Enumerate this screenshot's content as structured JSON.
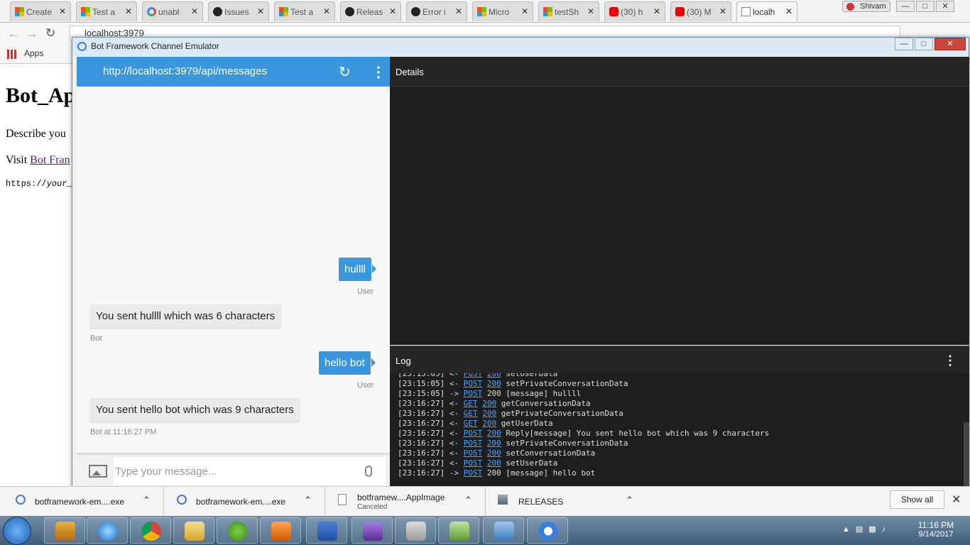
{
  "browser": {
    "tabs": [
      {
        "title": "Create",
        "favicon": "microsoft-icon"
      },
      {
        "title": "Test a",
        "favicon": "microsoft-icon"
      },
      {
        "title": "unabl",
        "favicon": "google-icon"
      },
      {
        "title": "Issues",
        "favicon": "github-icon"
      },
      {
        "title": "Test a",
        "favicon": "microsoft-icon"
      },
      {
        "title": "Releas",
        "favicon": "github-icon"
      },
      {
        "title": "Error i",
        "favicon": "github-icon"
      },
      {
        "title": "Micro",
        "favicon": "microsoft-icon"
      },
      {
        "title": "testSh",
        "favicon": "microsoft-icon"
      },
      {
        "title": "(30) h",
        "favicon": "youtube-icon"
      },
      {
        "title": "(30) M",
        "favicon": "youtube-icon"
      },
      {
        "title": "localh",
        "favicon": "page-icon"
      }
    ],
    "user": "Shivam",
    "address": "localhost:3979",
    "bookmarks_apps": "Apps"
  },
  "page": {
    "heading": "Bot_Ap",
    "desc": "Describe you",
    "visit_prefix": "Visit ",
    "visit_link": "Bot Fran",
    "code_prefix": "https://",
    "code_italic": "your_"
  },
  "emulator": {
    "window_title": "Bot Framework Channel Emulator",
    "endpoint": "http://localhost:3979/api/messages",
    "details_title": "Details",
    "log_title": "Log",
    "input_placeholder": "Type your message...",
    "messages": [
      {
        "from": "user",
        "text": "hullll",
        "meta": "User"
      },
      {
        "from": "bot",
        "text": "You sent hullll which was 6 characters",
        "meta": "Bot"
      },
      {
        "from": "user",
        "text": "hello bot",
        "meta": "User"
      },
      {
        "from": "bot",
        "text": "You sent hello bot which was 9 characters",
        "meta": "Bot at 11:16:27 PM"
      }
    ],
    "log": [
      {
        "time": "[23:15:05]",
        "dir": "<-",
        "method": "POST",
        "status": "200",
        "text": "setUserData",
        "status_link": true
      },
      {
        "time": "[23:15:05]",
        "dir": "<-",
        "method": "POST",
        "status": "200",
        "text": "setPrivateConversationData",
        "status_link": true
      },
      {
        "time": "[23:15:05]",
        "dir": "->",
        "method": "POST",
        "status": "200",
        "text": "[message] hullll",
        "status_link": false
      },
      {
        "time": "[23:16:27]",
        "dir": "<-",
        "method": "GET",
        "status": "200",
        "text": "getConversationData",
        "status_link": true
      },
      {
        "time": "[23:16:27]",
        "dir": "<-",
        "method": "GET",
        "status": "200",
        "text": "getPrivateConversationData",
        "status_link": true
      },
      {
        "time": "[23:16:27]",
        "dir": "<-",
        "method": "GET",
        "status": "200",
        "text": "getUserData",
        "status_link": true
      },
      {
        "time": "[23:16:27]",
        "dir": "<-",
        "method": "POST",
        "status": "200",
        "text": "Reply[message] You sent hello bot which was 9 characters",
        "status_link": true
      },
      {
        "time": "[23:16:27]",
        "dir": "<-",
        "method": "POST",
        "status": "200",
        "text": "setPrivateConversationData",
        "status_link": true
      },
      {
        "time": "[23:16:27]",
        "dir": "<-",
        "method": "POST",
        "status": "200",
        "text": "setConversationData",
        "status_link": true
      },
      {
        "time": "[23:16:27]",
        "dir": "<-",
        "method": "POST",
        "status": "200",
        "text": "setUserData",
        "status_link": true
      },
      {
        "time": "[23:16:27]",
        "dir": "->",
        "method": "POST",
        "status": "200",
        "text": "[message] hello bot",
        "status_link": false
      }
    ]
  },
  "downloads": {
    "items": [
      {
        "name": "botframework-em....exe",
        "sub": ""
      },
      {
        "name": "botframework-em....exe",
        "sub": ""
      },
      {
        "name": "botframew....AppImage",
        "sub": "Canceled"
      },
      {
        "name": "RELEASES",
        "sub": ""
      }
    ],
    "show_all": "Show all"
  },
  "taskbar": {
    "time": "11:16 PM",
    "date": "9/14/2017"
  },
  "colors": {
    "accent": "#3a96dd",
    "panel_dark": "#1e1e1e",
    "link": "#4aa3ff"
  }
}
